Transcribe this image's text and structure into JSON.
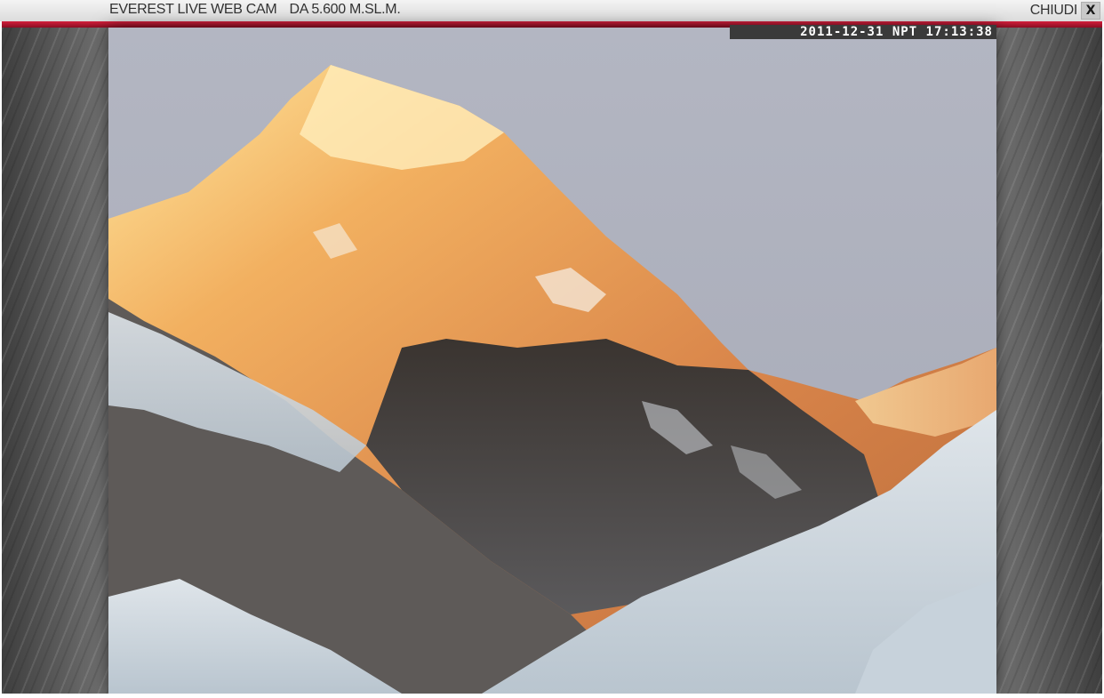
{
  "window": {
    "title": "EVEREST LIVE WEB CAM",
    "subtitle": "DA 5.600 M.SL.M.",
    "close_label": "CHIUDI",
    "close_icon_glyph": "X",
    "accent_color": "#c01a33"
  },
  "webcam": {
    "timestamp": "2011-12-31 NPT 17:13:38",
    "image_description_icon": "mountain-photo"
  }
}
